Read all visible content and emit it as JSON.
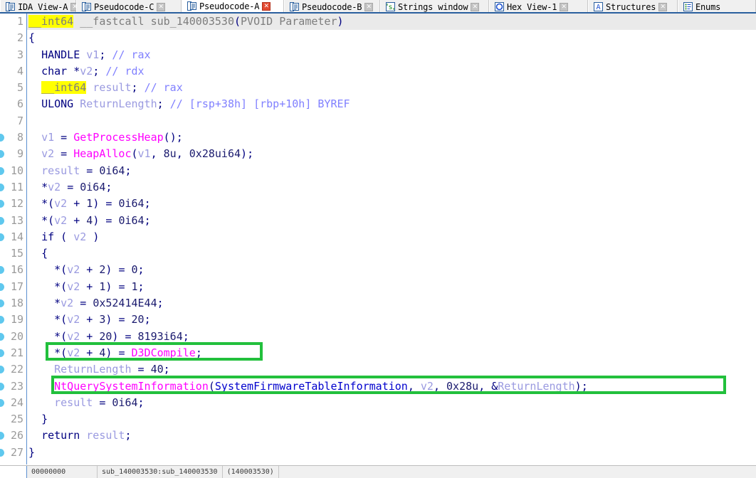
{
  "window": {
    "app": "IDA Pro",
    "accent_blue": "#2a5f9e",
    "annotation_color": "#22c03c",
    "highlight_color": "#ffff00"
  },
  "tabs": [
    {
      "label": "IDA View-A",
      "icon": "document-lines-icon",
      "active": false,
      "closable": true,
      "close_label": "✕"
    },
    {
      "label": "Pseudocode-C",
      "icon": "document-lines-icon",
      "active": false,
      "closable": true,
      "close_label": "✕"
    },
    {
      "label": "Pseudocode-A",
      "icon": "document-lines-icon",
      "active": true,
      "closable": true,
      "close_label": "✕"
    },
    {
      "label": "Pseudocode-B",
      "icon": "document-lines-icon",
      "active": false,
      "closable": true,
      "close_label": "✕"
    },
    {
      "label": "Strings window",
      "icon": "strings-s-icon",
      "active": false,
      "closable": true,
      "close_label": "✕"
    },
    {
      "label": "Hex View-1",
      "icon": "hex-circle-icon",
      "active": false,
      "closable": true,
      "close_label": "✕"
    },
    {
      "label": "Structures",
      "icon": "structures-a-icon",
      "active": false,
      "closable": true,
      "close_label": "✕"
    },
    {
      "label": "Enums",
      "icon": "enums-list-icon",
      "active": false,
      "closable": false,
      "close_label": "✕"
    }
  ],
  "code": {
    "function_name": "sub_140003530",
    "lines": [
      {
        "n": "1",
        "dot": false,
        "current": true
      },
      {
        "n": "2",
        "dot": false,
        "current": false
      },
      {
        "n": "3",
        "dot": false,
        "current": false
      },
      {
        "n": "4",
        "dot": false,
        "current": false
      },
      {
        "n": "5",
        "dot": false,
        "current": false
      },
      {
        "n": "6",
        "dot": false,
        "current": false
      },
      {
        "n": "7",
        "dot": false,
        "current": false
      },
      {
        "n": "8",
        "dot": true,
        "current": false
      },
      {
        "n": "9",
        "dot": true,
        "current": false
      },
      {
        "n": "10",
        "dot": true,
        "current": false
      },
      {
        "n": "11",
        "dot": true,
        "current": false
      },
      {
        "n": "12",
        "dot": true,
        "current": false
      },
      {
        "n": "13",
        "dot": true,
        "current": false
      },
      {
        "n": "14",
        "dot": true,
        "current": false
      },
      {
        "n": "15",
        "dot": false,
        "current": false
      },
      {
        "n": "16",
        "dot": true,
        "current": false
      },
      {
        "n": "17",
        "dot": true,
        "current": false
      },
      {
        "n": "18",
        "dot": true,
        "current": false
      },
      {
        "n": "19",
        "dot": true,
        "current": false
      },
      {
        "n": "20",
        "dot": true,
        "current": false
      },
      {
        "n": "21",
        "dot": true,
        "current": false
      },
      {
        "n": "22",
        "dot": true,
        "current": false
      },
      {
        "n": "23",
        "dot": true,
        "current": false
      },
      {
        "n": "24",
        "dot": true,
        "current": false
      },
      {
        "n": "25",
        "dot": false,
        "current": false
      },
      {
        "n": "26",
        "dot": true,
        "current": false
      },
      {
        "n": "27",
        "dot": true,
        "current": false
      }
    ],
    "text": [
      "__int64 __fastcall sub_140003530(PVOID Parameter)",
      "{",
      "  HANDLE v1; // rax",
      "  char *v2; // rdx",
      "  __int64 result; // rax",
      "  ULONG ReturnLength; // [rsp+38h] [rbp+10h] BYREF",
      "",
      "  v1 = GetProcessHeap();",
      "  v2 = HeapAlloc(v1, 8u, 0x28ui64);",
      "  result = 0i64;",
      "  *v2 = 0i64;",
      "  *(v2 + 1) = 0i64;",
      "  *(v2 + 4) = 0i64;",
      "  if ( v2 )",
      "  {",
      "    *(v2 + 2) = 0;",
      "    *(v2 + 1) = 1;",
      "    *v2 = 0x52414E44;",
      "    *(v2 + 3) = 20;",
      "    *(v2 + 20) = 8193i64;",
      "    *(v2 + 4) = D3DCompile;",
      "    ReturnLength = 40;",
      "    NtQuerySystemInformation(SystemFirmwareTableInformation, v2, 0x28u, &ReturnLength);",
      "    result = 0i64;",
      "  }",
      "  return result;",
      "}"
    ],
    "highlighted_tokens": [
      "__int64"
    ],
    "annotations": [
      {
        "target_line": "21",
        "text": "*(v2 + 4) = D3DCompile;"
      },
      {
        "target_line": "23",
        "text": "NtQuerySystemInformation(SystemFirmwareTableInformation, v2, 0x28u, &ReturnLength);"
      }
    ]
  },
  "statusbar": {
    "address": "00000000",
    "location": "sub_140003530:sub_140003530",
    "offset": "(140003530)"
  }
}
